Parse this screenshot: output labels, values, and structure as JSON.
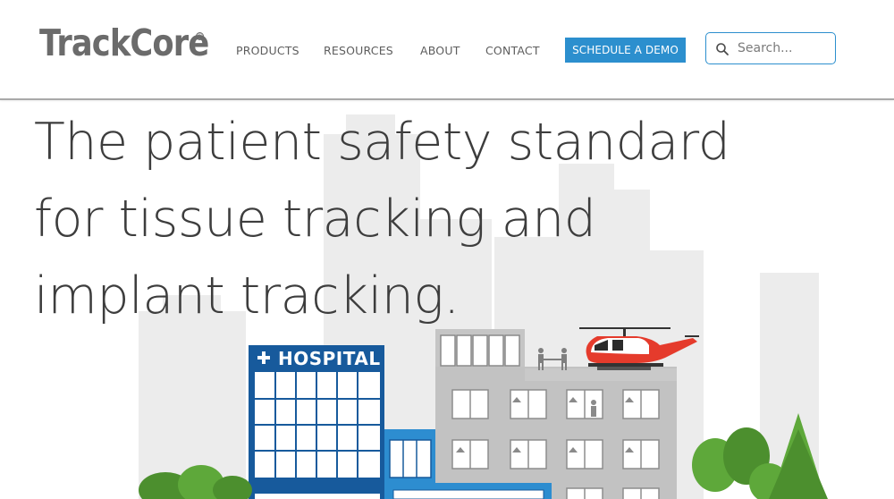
{
  "brand": {
    "name": "TrackCore",
    "registered_mark": "®"
  },
  "nav": {
    "items": [
      {
        "label": "PRODUCTS"
      },
      {
        "label": "RESOURCES"
      },
      {
        "label": "ABOUT"
      },
      {
        "label": "CONTACT"
      }
    ],
    "cta_label": "SCHEDULE A DEMO"
  },
  "search": {
    "placeholder": "Search...",
    "value": ""
  },
  "hero": {
    "headline_lines": [
      "The patient safety standard",
      "for tissue tracking and",
      "implant tracking."
    ],
    "hospital_sign": "HOSPITAL"
  },
  "colors": {
    "accent": "#2c8fce",
    "hospital_blue": "#175a9c",
    "building_gray": "#bfbfbf",
    "skyline_gray": "#ececec",
    "helicopter_red": "#e53b2c",
    "tree_green": "#5ea83a"
  },
  "icons": {
    "search": "search-icon",
    "hospital_cross": "medical-cross-icon",
    "helicopter": "helicopter-icon"
  }
}
